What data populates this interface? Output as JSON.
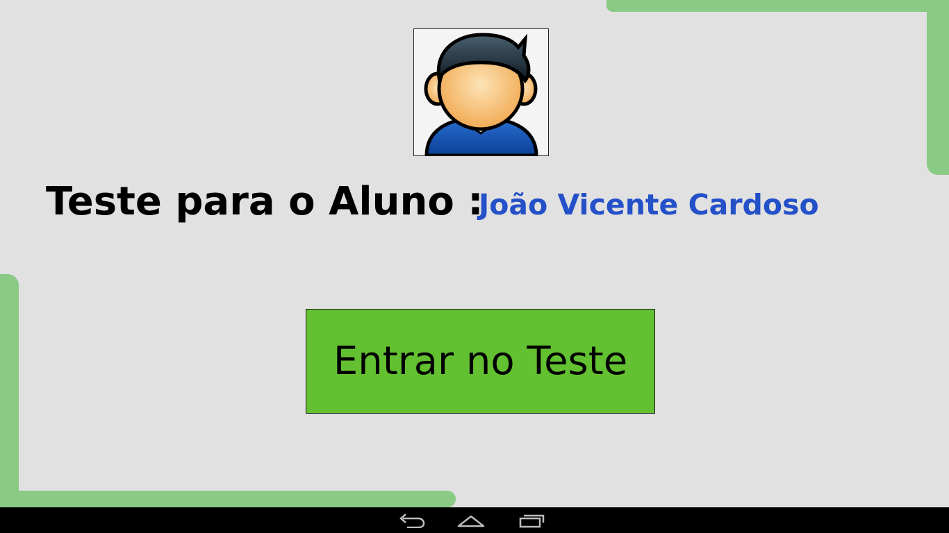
{
  "main": {
    "title_label": "Teste para o Aluno :",
    "student_name": "João Vicente Cardoso",
    "enter_button_label": "Entrar no Teste",
    "avatar_icon": "student-avatar-icon"
  },
  "navbar": {
    "back_icon": "back-icon",
    "home_icon": "home-icon",
    "recent_icon": "recent-apps-icon"
  },
  "colors": {
    "background": "#e1e1e1",
    "frame_green": "#89ca85",
    "button_green": "#63c131",
    "name_blue": "#2450c8",
    "navbar": "#000000"
  }
}
